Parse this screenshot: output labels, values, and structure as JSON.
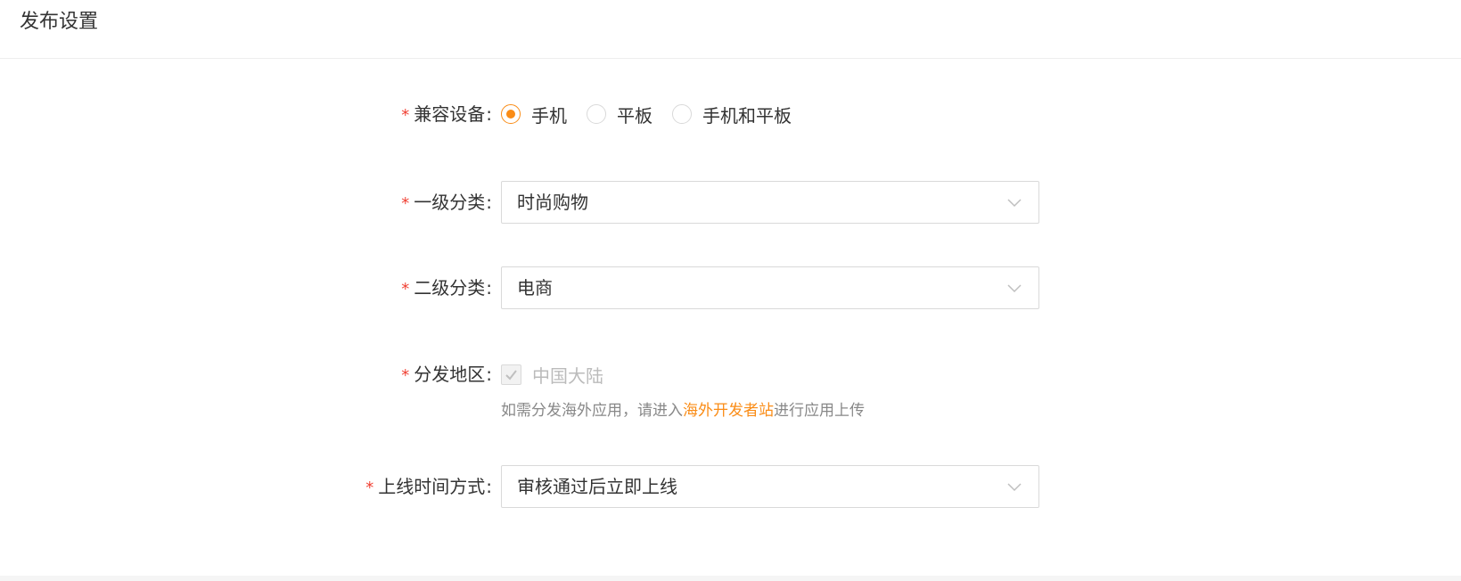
{
  "header": {
    "title": "发布设置"
  },
  "form": {
    "required_mark": "*",
    "colon": ":",
    "device": {
      "label": "兼容设备",
      "options": [
        "手机",
        "平板",
        "手机和平板"
      ],
      "selected": "手机"
    },
    "category_level1": {
      "label": "一级分类",
      "value": "时尚购物"
    },
    "category_level2": {
      "label": "二级分类",
      "value": "电商"
    },
    "region": {
      "label": "分发地区",
      "checkbox_label": "中国大陆",
      "checked": true,
      "disabled": true,
      "hint_prefix": "如需分发海外应用，请进入",
      "hint_link": "海外开发者站",
      "hint_suffix": "进行应用上传"
    },
    "release_time": {
      "label": "上线时间方式",
      "value": "审核通过后立即上线"
    }
  },
  "colors": {
    "accent": "#fa8c16",
    "required": "#f04134",
    "border": "#d9d9d9"
  },
  "icons": {
    "select_arrow": "chevron-down-icon",
    "checkbox_mark": "check-icon"
  }
}
